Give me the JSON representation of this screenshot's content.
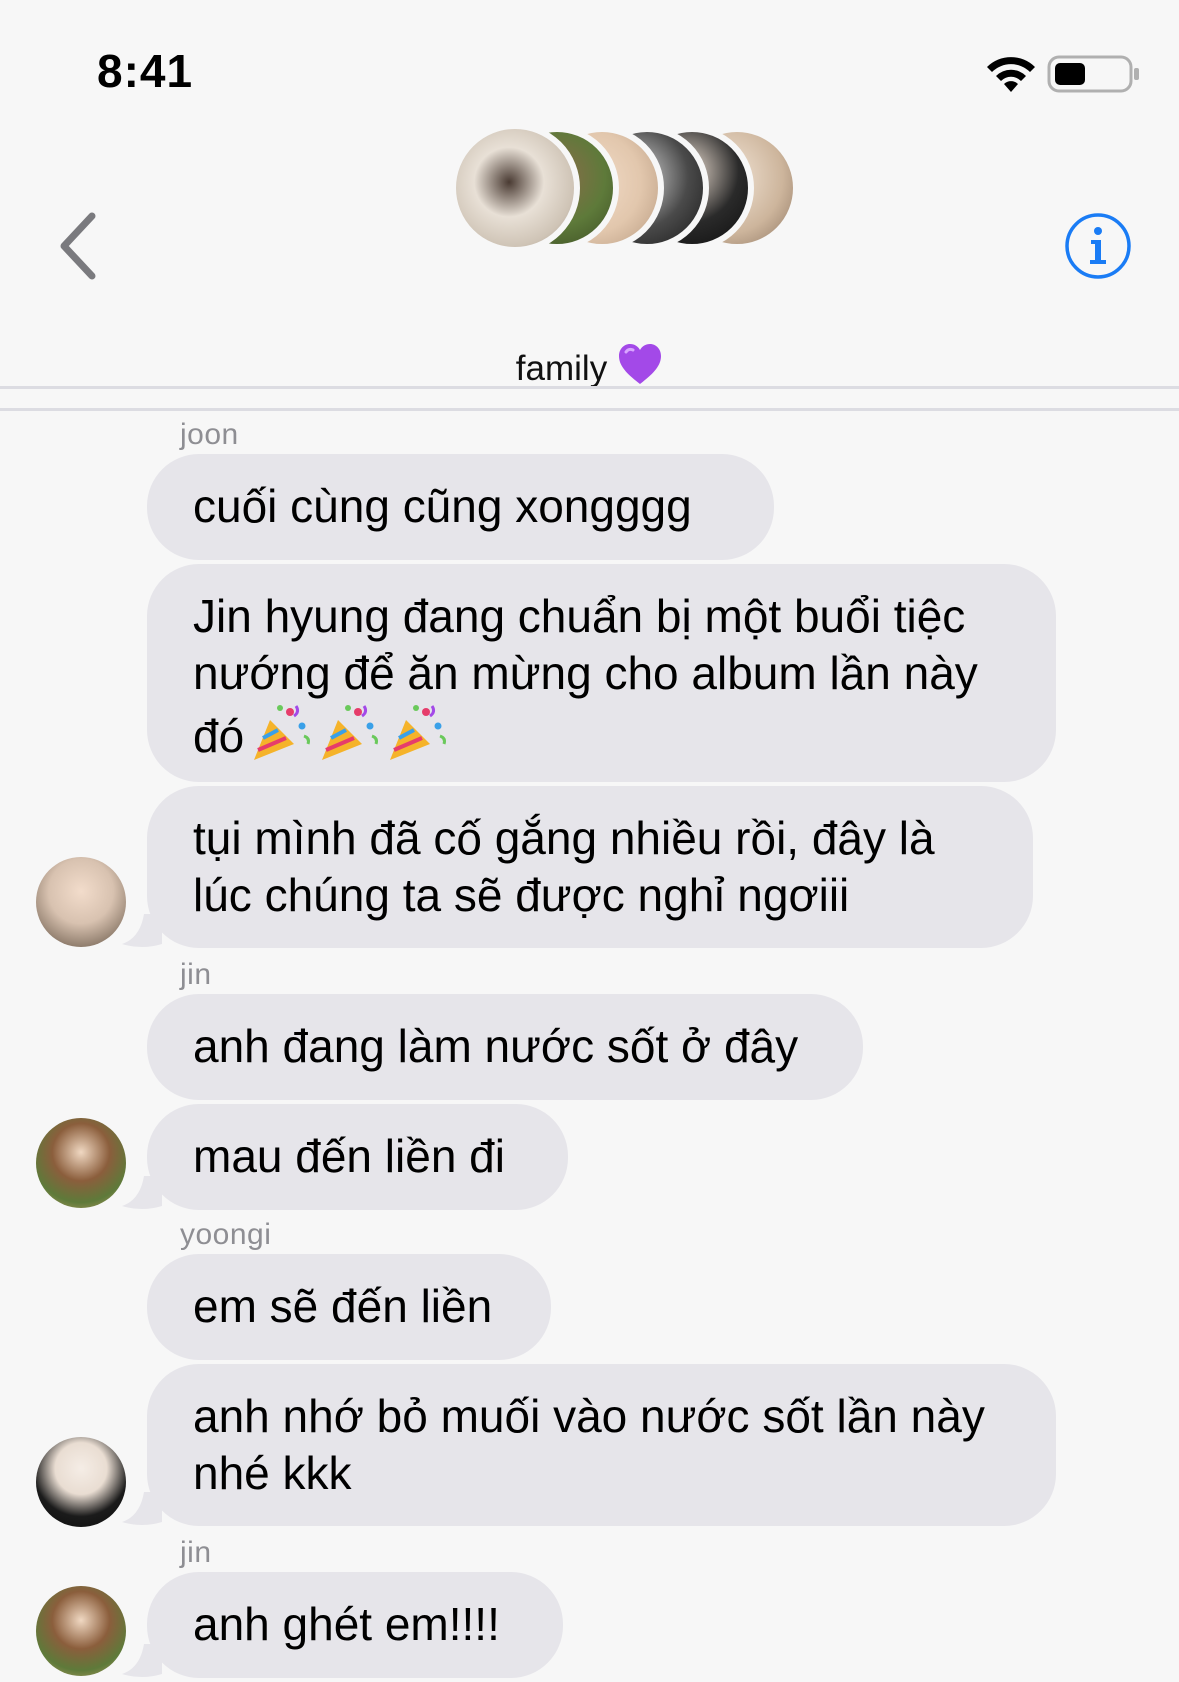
{
  "status": {
    "time": "8:41"
  },
  "header": {
    "group_name": "family",
    "back_label": "back",
    "info_label": "i"
  },
  "messages": [
    {
      "sender": "joon",
      "texts": [
        "cuối cùng cũng xongggg",
        "Jin hyung đang chuẩn bị một buổi tiệc nướng để ăn mừng cho album lần này đó",
        "tụi mình đã cố gắng nhiều rồi, đây là lúc chúng ta sẽ được nghỉ ngơiii"
      ]
    },
    {
      "sender": "jin",
      "texts": [
        "anh đang làm nước sốt ở đây",
        "mau đến liền đi"
      ]
    },
    {
      "sender": "yoongi",
      "texts": [
        "em sẽ đến liền",
        "anh nhớ bỏ muối vào nước sốt lần này nhé kkk"
      ]
    },
    {
      "sender": "jin",
      "texts": [
        "anh ghét em!!!!"
      ]
    }
  ],
  "colors": {
    "bubble": "#e6e5ea",
    "accent": "#1a7cf5",
    "sender": "#8e8e93",
    "background": "#f7f7f7"
  }
}
